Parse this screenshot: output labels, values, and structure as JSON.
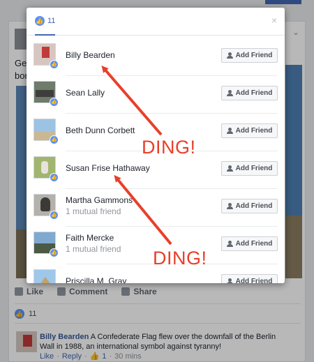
{
  "background": {
    "post_text_line1": "Ge",
    "post_text_line2": "bor",
    "actions": [
      "Like",
      "Comment",
      "Share"
    ],
    "like_count": "11",
    "comment": {
      "author": "Billy Bearden",
      "text": "A Confederate Flag flew over the downfall of the Berlin Wall in 1988, an international symbol against tyranny!",
      "meta": {
        "like": "Like",
        "separator": "·",
        "reply": "Reply",
        "likes": "1",
        "time": "30 mins"
      }
    }
  },
  "dialog": {
    "tab_count": "11",
    "close_glyph": "×",
    "add_friend_label": "Add Friend",
    "people": [
      {
        "name": "Billy Bearden",
        "sub": ""
      },
      {
        "name": "Sean Lally",
        "sub": ""
      },
      {
        "name": "Beth Dunn Corbett",
        "sub": ""
      },
      {
        "name": "Susan Frise Hathaway",
        "sub": ""
      },
      {
        "name": "Martha Gammons",
        "sub": "1 mutual friend"
      },
      {
        "name": "Faith Mercke",
        "sub": "1 mutual friend"
      },
      {
        "name": "Priscilla M. Gray",
        "sub": ""
      }
    ]
  },
  "annotations": {
    "ding_1": "DING!",
    "ding_2": "DING!",
    "color": "#e8402a"
  },
  "icons": [
    "like-icon",
    "close-icon",
    "add-friend-icon",
    "comment-icon",
    "share-icon"
  ],
  "colors": {
    "brand": "#4267b2",
    "like_blue": "#5890ff",
    "link": "#365899"
  }
}
